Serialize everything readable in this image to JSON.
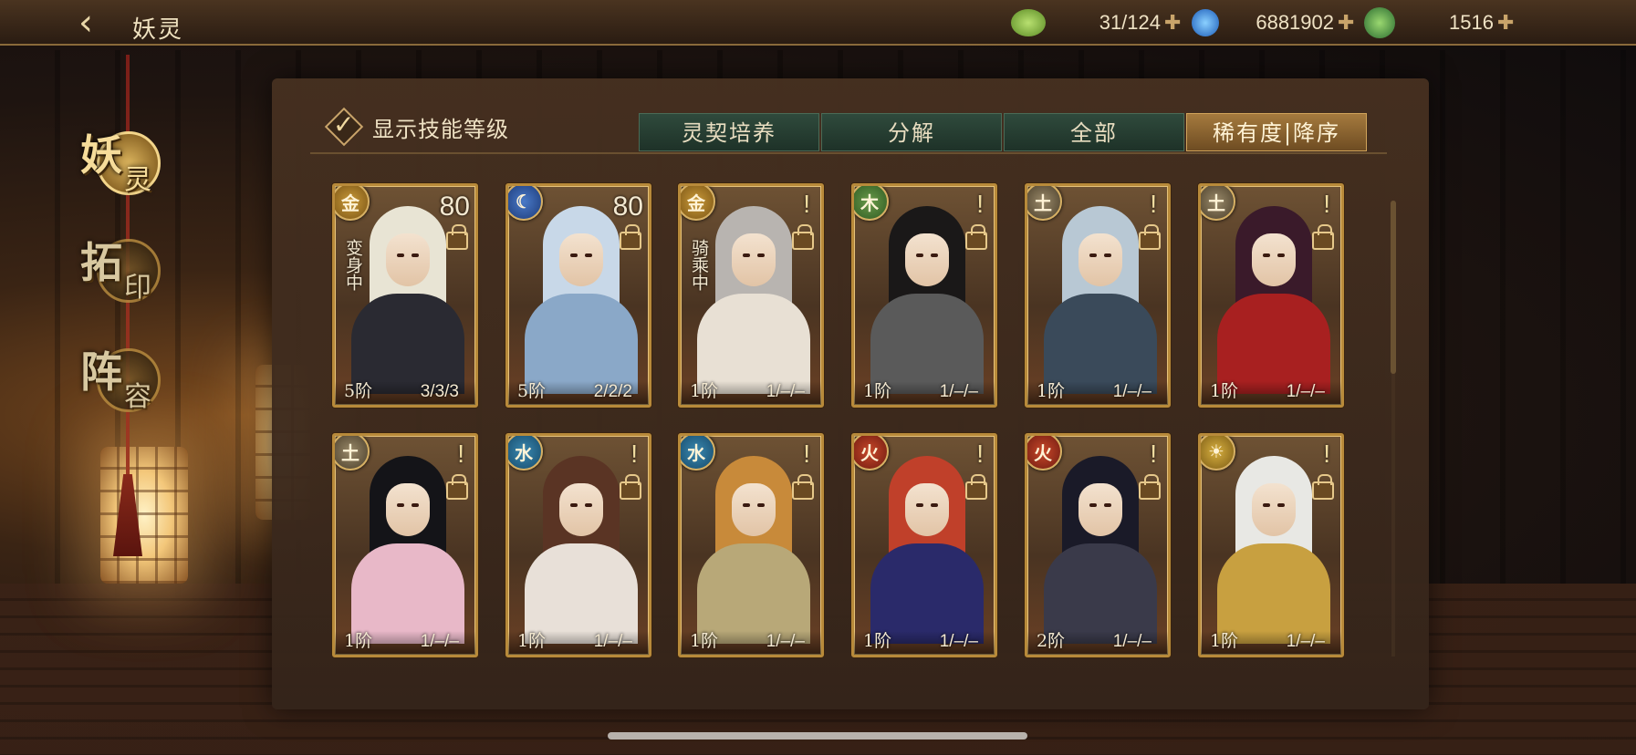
{
  "header": {
    "title": "妖灵",
    "resources": [
      {
        "icon": "jade-icon",
        "value": "31/124",
        "color": "#8fbf4a"
      },
      {
        "icon": "blue-flame-icon",
        "value": "6881902",
        "color": "#3a8ee6"
      },
      {
        "icon": "leaf-coin-icon",
        "value": "1516",
        "color": "#4aa050"
      }
    ]
  },
  "sidebar": {
    "items": [
      {
        "char1": "妖",
        "char2": "灵",
        "active": true
      },
      {
        "char1": "拓",
        "char2": "印",
        "active": false
      },
      {
        "char1": "阵",
        "char2": "容",
        "active": false
      }
    ]
  },
  "toolbar": {
    "show_skill_label": "显示技能等级",
    "tabs": [
      "灵契培养",
      "分解",
      "全部",
      "稀有度|降序"
    ]
  },
  "cards": [
    {
      "element": "metal",
      "element_glyph": "金",
      "level": "80",
      "status": "变身中",
      "tier": "5阶",
      "skills": "3/3/3",
      "hair": "#e8e4d4",
      "body": "#2a2a32"
    },
    {
      "element": "moon",
      "element_glyph": "☾",
      "level": "80",
      "status": "",
      "tier": "5阶",
      "skills": "2/2/2",
      "hair": "#c8d8e8",
      "body": "#8aa8c8"
    },
    {
      "element": "metal",
      "element_glyph": "金",
      "level": "",
      "status": "骑乘中",
      "tier": "1阶",
      "skills": "1/–/–",
      "hair": "#b8b4b0",
      "body": "#e8e0d4"
    },
    {
      "element": "wood",
      "element_glyph": "木",
      "level": "",
      "status": "",
      "tier": "1阶",
      "skills": "1/–/–",
      "hair": "#1a1818",
      "body": "#5a5a5a"
    },
    {
      "element": "earth",
      "element_glyph": "土",
      "level": "",
      "status": "",
      "tier": "1阶",
      "skills": "1/–/–",
      "hair": "#b8c8d4",
      "body": "#3a4a5a"
    },
    {
      "element": "earth",
      "element_glyph": "土",
      "level": "",
      "status": "",
      "tier": "1阶",
      "skills": "1/–/–",
      "hair": "#3a1a2a",
      "body": "#a82020"
    },
    {
      "element": "earth",
      "element_glyph": "土",
      "level": "",
      "status": "",
      "tier": "1阶",
      "skills": "1/–/–",
      "hair": "#141418",
      "body": "#e8b8c8"
    },
    {
      "element": "water",
      "element_glyph": "水",
      "level": "",
      "status": "",
      "tier": "1阶",
      "skills": "1/–/–",
      "hair": "#5a3424",
      "body": "#e8e0d8"
    },
    {
      "element": "water",
      "element_glyph": "水",
      "level": "",
      "status": "",
      "tier": "1阶",
      "skills": "1/–/–",
      "hair": "#c88a3a",
      "body": "#b8a878"
    },
    {
      "element": "fire",
      "element_glyph": "火",
      "level": "",
      "status": "",
      "tier": "1阶",
      "skills": "1/–/–",
      "hair": "#c0402a",
      "body": "#2a2a6a"
    },
    {
      "element": "fire",
      "element_glyph": "火",
      "level": "",
      "status": "",
      "tier": "2阶",
      "skills": "1/–/–",
      "hair": "#1a1a28",
      "body": "#3a3a4a"
    },
    {
      "element": "sun",
      "element_glyph": "☀",
      "level": "",
      "status": "",
      "tier": "1阶",
      "skills": "1/–/–",
      "hair": "#e8e8e4",
      "body": "#c8a040"
    }
  ]
}
